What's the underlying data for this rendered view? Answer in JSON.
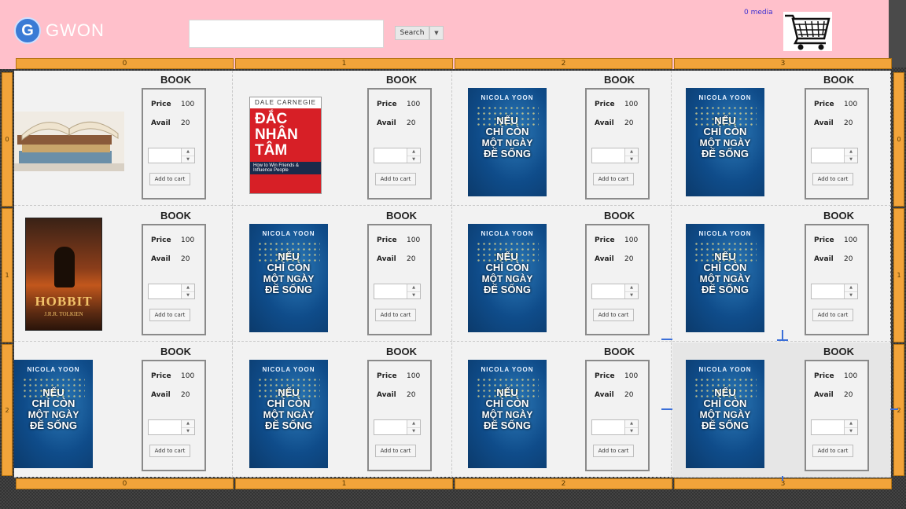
{
  "header": {
    "logo_letter": "G",
    "logo_text": "GWON",
    "search": {
      "value": "",
      "placeholder": ""
    },
    "search_button": "Search",
    "search_dropdown": "▼",
    "media_count": "0 media",
    "cart_icon": "shopping-cart-icon"
  },
  "rulers": {
    "columns": [
      "0",
      "1",
      "2",
      "3"
    ],
    "rows": [
      "0",
      "1",
      "2"
    ]
  },
  "products": [
    {
      "title": "BOOK",
      "price_label": "Price",
      "price": "100",
      "avail_label": "Avail",
      "avail": "20",
      "qty": "",
      "add_label": "Add to cart",
      "cover": "books-stack"
    },
    {
      "title": "BOOK",
      "price_label": "Price",
      "price": "100",
      "avail_label": "Avail",
      "avail": "20",
      "qty": "",
      "add_label": "Add to cart",
      "cover": "dac-nhan-tam"
    },
    {
      "title": "BOOK",
      "price_label": "Price",
      "price": "100",
      "avail_label": "Avail",
      "avail": "20",
      "qty": "",
      "add_label": "Add to cart",
      "cover": "neu-chi-con"
    },
    {
      "title": "BOOK",
      "price_label": "Price",
      "price": "100",
      "avail_label": "Avail",
      "avail": "20",
      "qty": "",
      "add_label": "Add to cart",
      "cover": "neu-chi-con"
    },
    {
      "title": "BOOK",
      "price_label": "Price",
      "price": "100",
      "avail_label": "Avail",
      "avail": "20",
      "qty": "",
      "add_label": "Add to cart",
      "cover": "hobbit"
    },
    {
      "title": "BOOK",
      "price_label": "Price",
      "price": "100",
      "avail_label": "Avail",
      "avail": "20",
      "qty": "",
      "add_label": "Add to cart",
      "cover": "neu-chi-con"
    },
    {
      "title": "BOOK",
      "price_label": "Price",
      "price": "100",
      "avail_label": "Avail",
      "avail": "20",
      "qty": "",
      "add_label": "Add to cart",
      "cover": "neu-chi-con"
    },
    {
      "title": "BOOK",
      "price_label": "Price",
      "price": "100",
      "avail_label": "Avail",
      "avail": "20",
      "qty": "",
      "add_label": "Add to cart",
      "cover": "neu-chi-con"
    },
    {
      "title": "BOOK",
      "price_label": "Price",
      "price": "100",
      "avail_label": "Avail",
      "avail": "20",
      "qty": "",
      "add_label": "Add to cart",
      "cover": "neu-chi-con"
    },
    {
      "title": "BOOK",
      "price_label": "Price",
      "price": "100",
      "avail_label": "Avail",
      "avail": "20",
      "qty": "",
      "add_label": "Add to cart",
      "cover": "neu-chi-con"
    },
    {
      "title": "BOOK",
      "price_label": "Price",
      "price": "100",
      "avail_label": "Avail",
      "avail": "20",
      "qty": "",
      "add_label": "Add to cart",
      "cover": "neu-chi-con"
    },
    {
      "title": "BOOK",
      "price_label": "Price",
      "price": "100",
      "avail_label": "Avail",
      "avail": "20",
      "qty": "",
      "add_label": "Add to cart",
      "cover": "neu-chi-con"
    }
  ],
  "covers": {
    "dac-nhan-tam": {
      "author": "DALE CARNEGIE",
      "title1": "ĐẮC",
      "title2": "NHÂN",
      "title3": "TÂM",
      "subtitle": "How to Win Friends & Influence People"
    },
    "neu-chi-con": {
      "author": "NICOLA YOON",
      "title1": "NẾU",
      "title2": "CHỈ CÒN",
      "title3": "MỘT NGÀY",
      "title4": "ĐỂ SỐNG"
    },
    "hobbit": {
      "title": "HOBBIT",
      "author": "J.R.R. TOLKIEN"
    }
  },
  "colors": {
    "header_bg": "#ffc0cb",
    "ruler": "#f2a43a",
    "grid_bg": "#f2f2f2",
    "guide": "#3b6fd8",
    "cover_blue": "#0f4c8a",
    "cover_red": "#d71f26"
  }
}
